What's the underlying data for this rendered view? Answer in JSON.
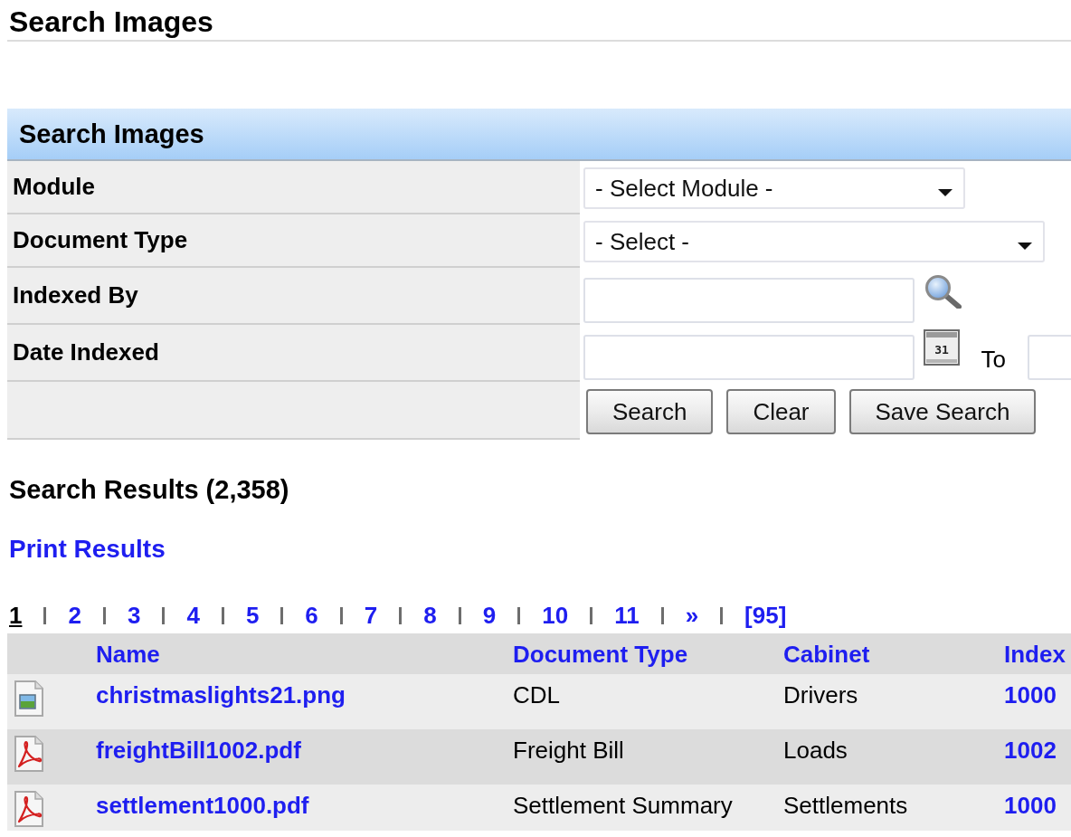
{
  "page_title": "Search Images",
  "search_panel": {
    "title": "Search Images",
    "fields": [
      {
        "kind": "select",
        "label": "Module",
        "value": "- Select Module -"
      },
      {
        "kind": "select",
        "label": "Document Type",
        "value": "- Select -"
      },
      {
        "kind": "lookup",
        "label": "Indexed By"
      },
      {
        "kind": "date_range",
        "label": "Date Indexed",
        "calendar_text": "31",
        "to_label": "To"
      }
    ],
    "buttons": [
      "Search",
      "Clear",
      "Save Search"
    ]
  },
  "results": {
    "title": "Search Results (2,358)",
    "print_link": "Print Results",
    "pages": [
      {
        "label": "1",
        "selected": true
      },
      {
        "label": "2",
        "selected": false
      },
      {
        "label": "3",
        "selected": false
      },
      {
        "label": "4",
        "selected": false
      },
      {
        "label": "5",
        "selected": false
      },
      {
        "label": "6",
        "selected": false
      },
      {
        "label": "7",
        "selected": false
      },
      {
        "label": "8",
        "selected": false
      },
      {
        "label": "9",
        "selected": false
      },
      {
        "label": "10",
        "selected": false
      },
      {
        "label": "11",
        "selected": false
      },
      {
        "label": "»",
        "selected": false
      },
      {
        "label": "[95]",
        "selected": false
      }
    ],
    "table": {
      "columns": [
        "Name",
        "Document Type",
        "Cabinet",
        "Index"
      ],
      "rows": [
        {
          "kind": "image",
          "name": "christmaslights21.png",
          "document_type": "CDL",
          "cabinet": "Drivers",
          "index": "1000"
        },
        {
          "kind": "pdf",
          "name": "freightBill1002.pdf",
          "document_type": "Freight Bill",
          "cabinet": "Loads",
          "index": "1002"
        },
        {
          "kind": "pdf",
          "name": "settlement1000.pdf",
          "document_type": "Settlement Summary",
          "cabinet": "Settlements",
          "index": "1000"
        }
      ]
    }
  }
}
